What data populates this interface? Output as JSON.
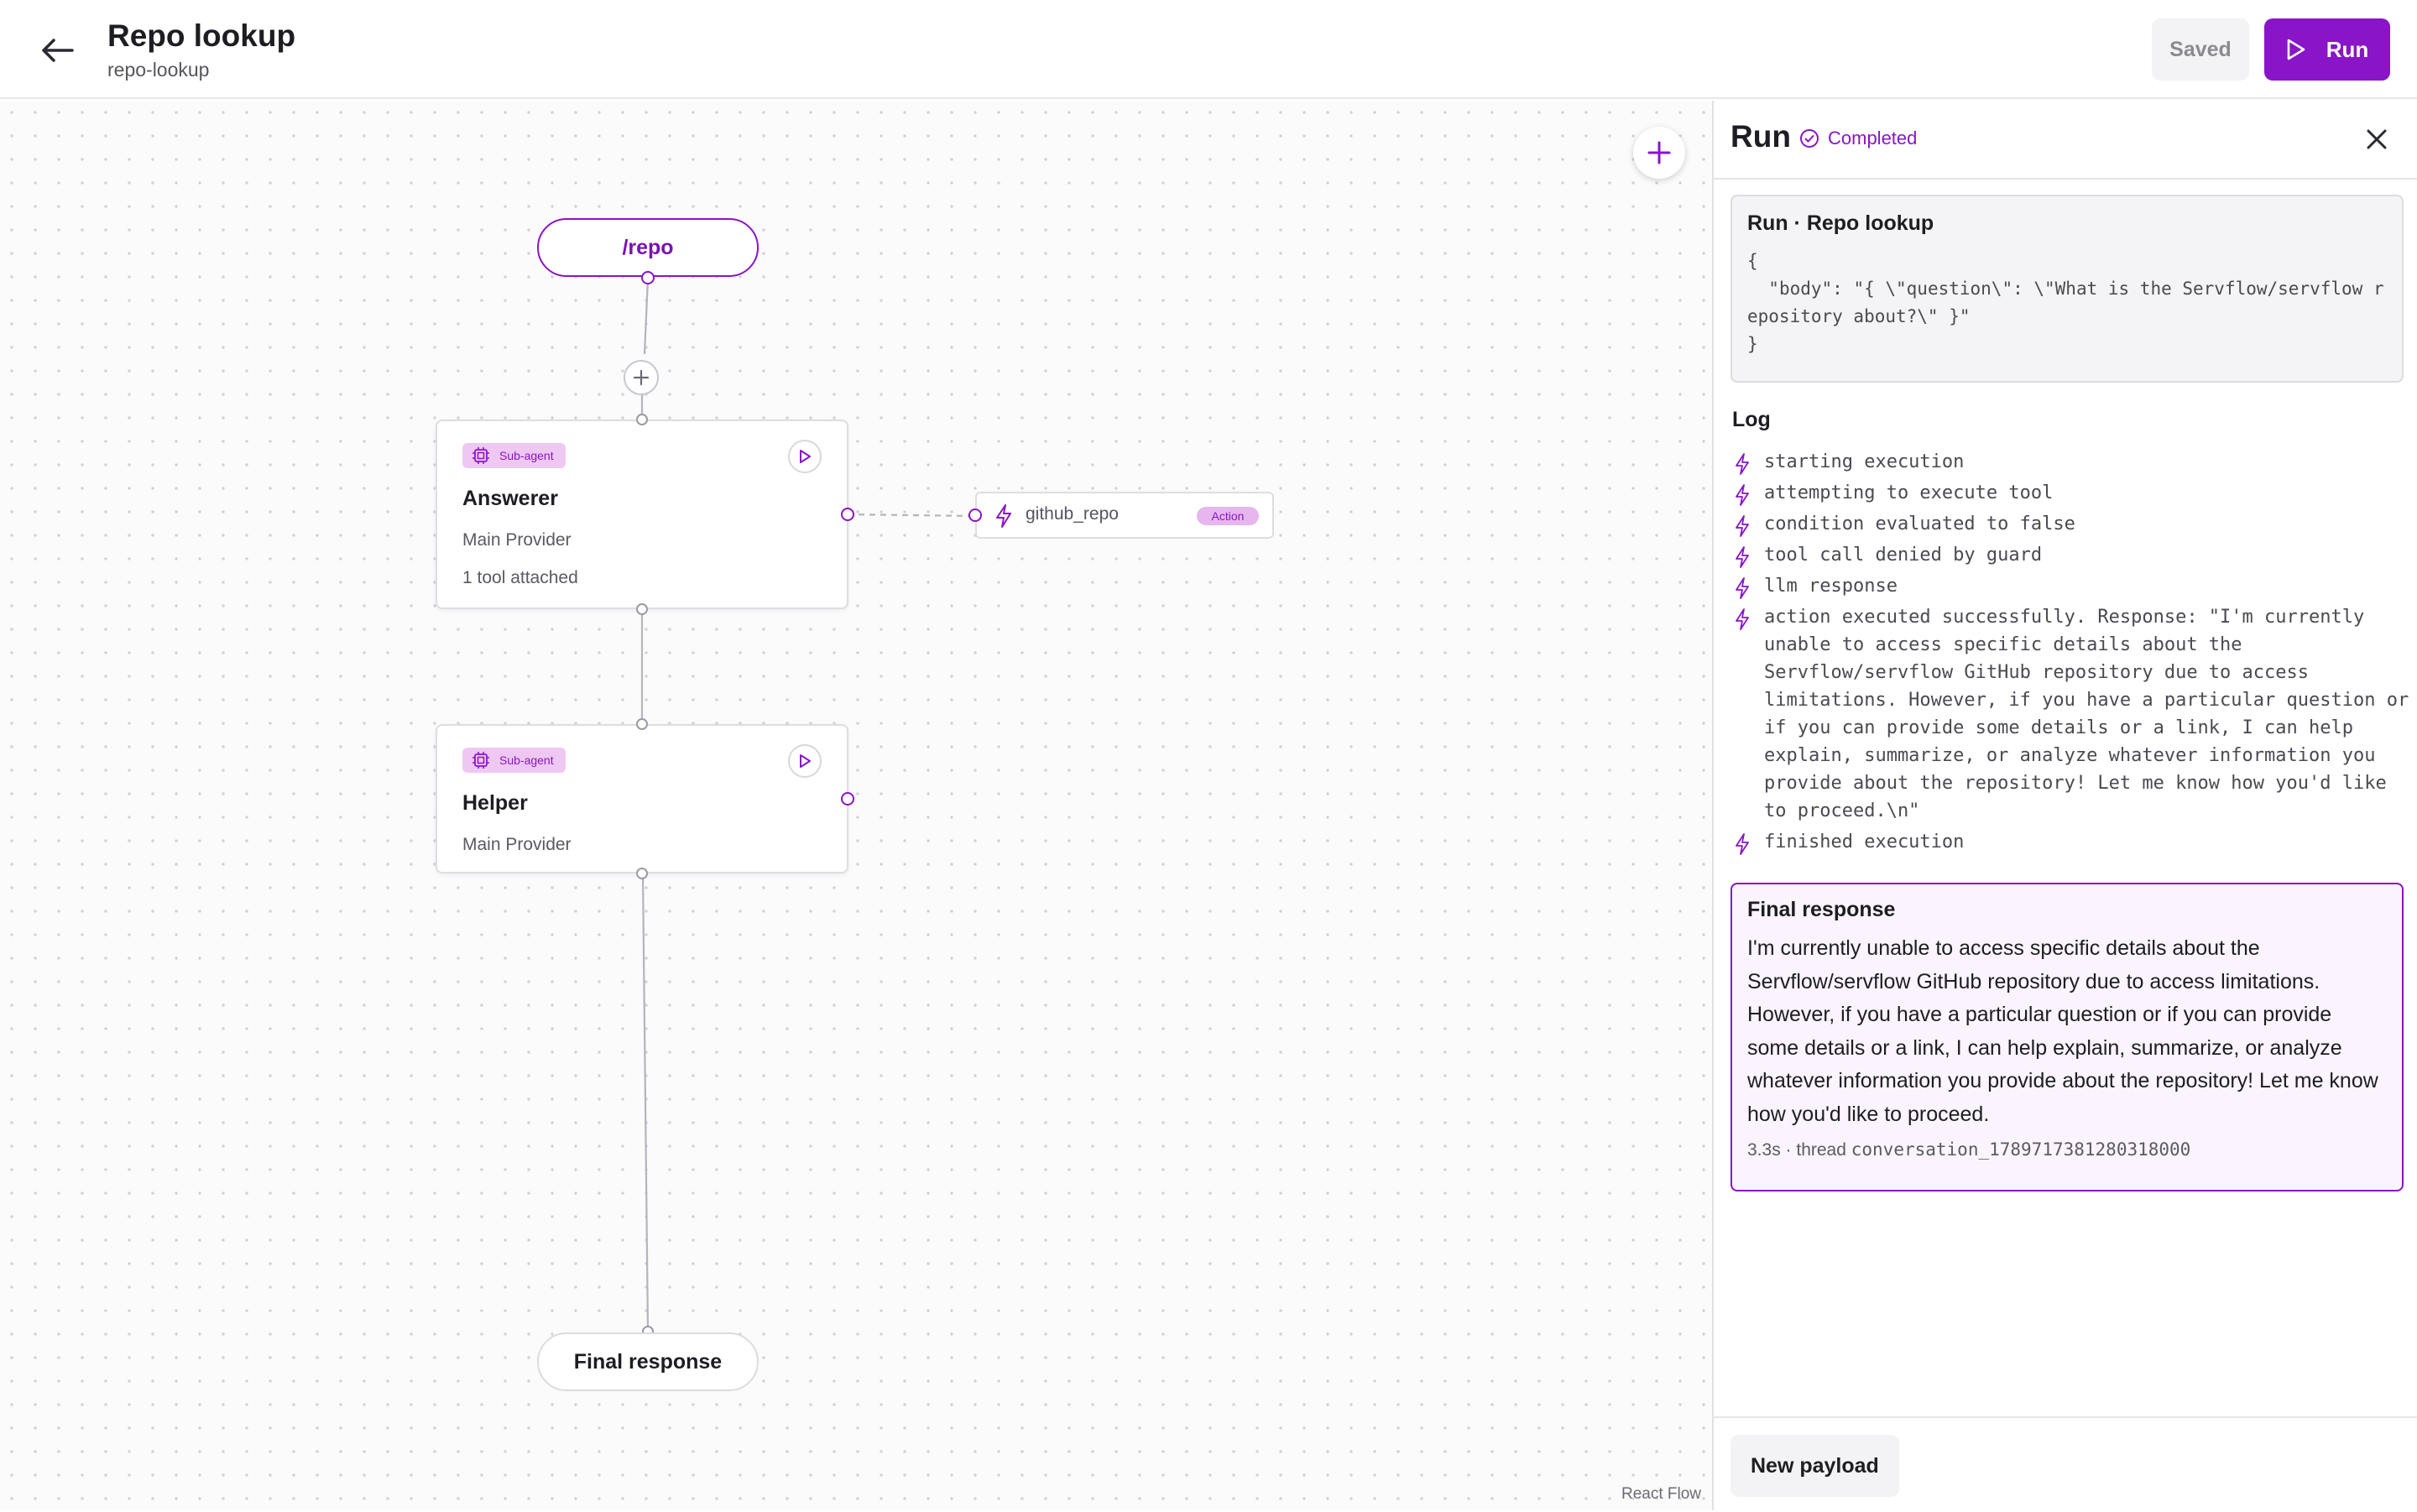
{
  "header": {
    "title": "Repo lookup",
    "slug": "repo-lookup",
    "saved_label": "Saved",
    "run_label": "Run"
  },
  "colors": {
    "accent": "#8a14c7",
    "badge_bg": "#eec8f2",
    "final_bg": "#fbf3fd"
  },
  "canvas": {
    "trigger": {
      "label": "/repo"
    },
    "agents": [
      {
        "badge": "Sub-agent",
        "name": "Answerer",
        "provider": "Main Provider",
        "tools": "1 tool attached"
      },
      {
        "badge": "Sub-agent",
        "name": "Helper",
        "provider": "Main Provider"
      }
    ],
    "tool": {
      "name": "github_repo",
      "badge": "Action",
      "icon": "lightning-icon"
    },
    "final": {
      "label": "Final response"
    },
    "attribution": "React Flow"
  },
  "run_panel": {
    "title": "Run",
    "status": "Completed",
    "payload": {
      "title": "Run · Repo lookup",
      "code": "{\n  \"body\": \"{ \\\"question\\\": \\\"What is the Servflow/servflow repository about?\\\" }\"\n}"
    },
    "log_title": "Log",
    "log": [
      "starting execution",
      "attempting to execute tool",
      "condition evaluated to false",
      "tool call denied by guard",
      "llm response",
      "action executed successfully. Response: \"I'm currently unable to access specific details about the Servflow/servflow GitHub repository due to access limitations. However, if you have a particular question or if you can provide some details or a link, I can help explain, summarize, or analyze whatever information you provide about the repository! Let me know how you'd like to proceed.\\n\"",
      "finished execution"
    ],
    "final_response": {
      "title": "Final response",
      "text": "I'm currently unable to access specific details about the Servflow/servflow GitHub repository due to access limitations. However, if you have a particular question or if you can provide some details or a link, I can help explain, summarize, or analyze whatever information you provide about the repository! Let me know how you'd like to proceed.",
      "duration": "3.3s · thread",
      "thread_id": "conversation_1789717381280318000"
    },
    "new_payload_label": "New payload"
  }
}
